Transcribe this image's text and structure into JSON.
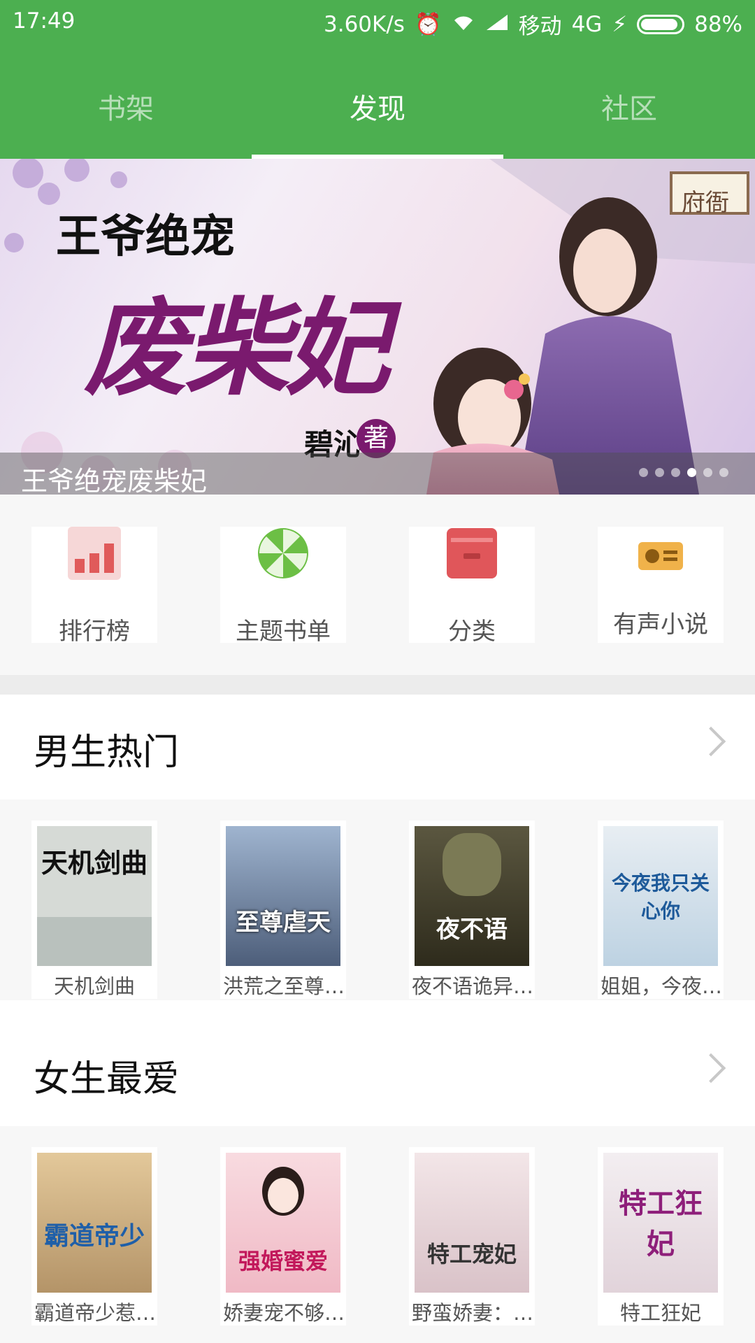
{
  "status_bar": {
    "time": "17:49",
    "speed": "3.60K/s",
    "carrier": "移动",
    "network": "4G",
    "battery": "88%"
  },
  "tabs": [
    {
      "label": "书架",
      "active": false
    },
    {
      "label": "发现",
      "active": true
    },
    {
      "label": "社区",
      "active": false
    }
  ],
  "banner": {
    "caption": "王爷绝宠废柴妃",
    "art_title_small": "王爷绝宠",
    "art_title_large": "废柴妃",
    "art_author": "碧沁",
    "art_author_suffix": "著",
    "art_sign": "府衙",
    "dots_total": 6,
    "active_dot": 4
  },
  "shortcuts": [
    {
      "label": "排行榜",
      "icon": "ranking-bars-icon",
      "color": "#e05a5a"
    },
    {
      "label": "主题书单",
      "icon": "pinwheel-icon",
      "color": "#6cbf45"
    },
    {
      "label": "分类",
      "icon": "category-box-icon",
      "color": "#e0565a"
    },
    {
      "label": "有声小说",
      "icon": "radio-icon",
      "color": "#f0b24a"
    }
  ],
  "sections": [
    {
      "title": "男生热门",
      "books": [
        {
          "title": "天机剑曲",
          "cover_text": "天机剑曲",
          "cover_color": "#d6dad6"
        },
        {
          "title": "洪荒之至尊…",
          "cover_text": "至尊虐天",
          "cover_color": "#5b6e8a"
        },
        {
          "title": "夜不语诡异…",
          "cover_text": "夜不语",
          "cover_color": "#3c3a2a"
        },
        {
          "title": "姐姐，今夜…",
          "cover_text": "今夜我只关心你",
          "cover_color": "#c9dbe8"
        }
      ]
    },
    {
      "title": "女生最爱",
      "books": [
        {
          "title": "霸道帝少惹…",
          "cover_text": "霸道帝少",
          "cover_color": "#d7b98b"
        },
        {
          "title": "娇妻宠不够…",
          "cover_text": "强婚蜜爱",
          "cover_color": "#f3c9d1"
        },
        {
          "title": "野蛮娇妻：…",
          "cover_text": "特工宠妃",
          "cover_color": "#e9d8dc"
        },
        {
          "title": "特工狂妃",
          "cover_text": "特工狂妃",
          "cover_color": "#ece6ea"
        }
      ]
    }
  ],
  "colors": {
    "primary": "#4caf50"
  }
}
